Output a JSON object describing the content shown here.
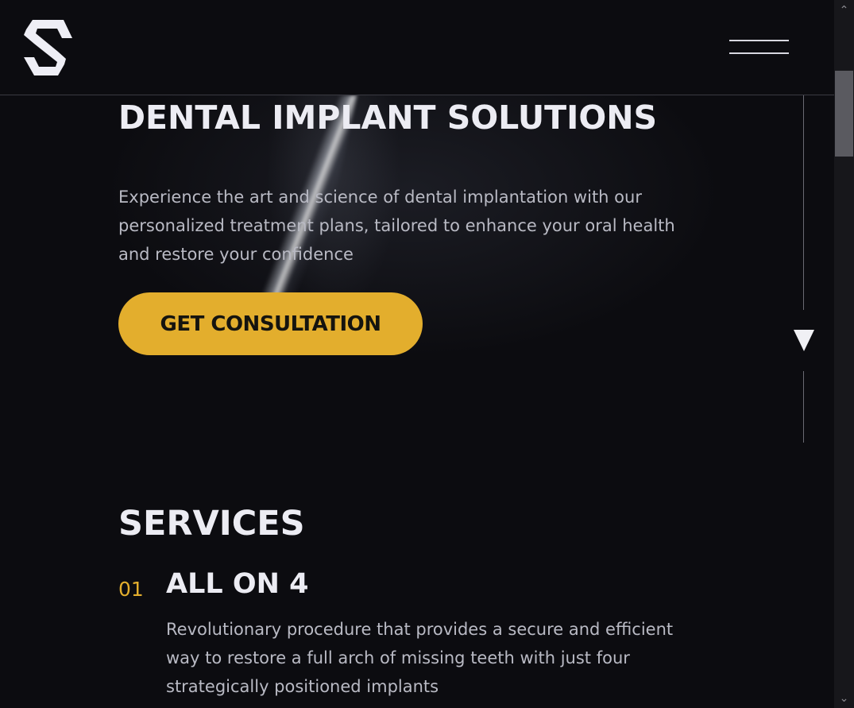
{
  "header": {
    "logo_icon": "s-logo-icon",
    "menu_icon": "hamburger-menu-icon"
  },
  "hero": {
    "title": "DENTAL IMPLANT SOLUTIONS",
    "description": "Experience the art and science of dental implantation with our personalized treatment plans, tailored to enhance your oral health and restore your confidence",
    "cta_label": "GET CONSULTATION",
    "scroll_icon": "triangle-down-icon"
  },
  "services": {
    "title": "SERVICES",
    "items": [
      {
        "number": "01",
        "title": "ALL ON 4",
        "description": "Revolutionary procedure that provides a secure and efficient way to restore a full arch of missing teeth with just four strategically positioned implants"
      }
    ]
  },
  "scrollbar": {
    "up_icon": "chevron-up-icon",
    "down_icon": "chevron-down-icon",
    "up_glyph": "⌃",
    "down_glyph": "⌄"
  },
  "colors": {
    "background": "#0c0c10",
    "accent": "#e3ae2d",
    "text_primary": "#ececf3",
    "text_secondary": "#b9bac4"
  }
}
